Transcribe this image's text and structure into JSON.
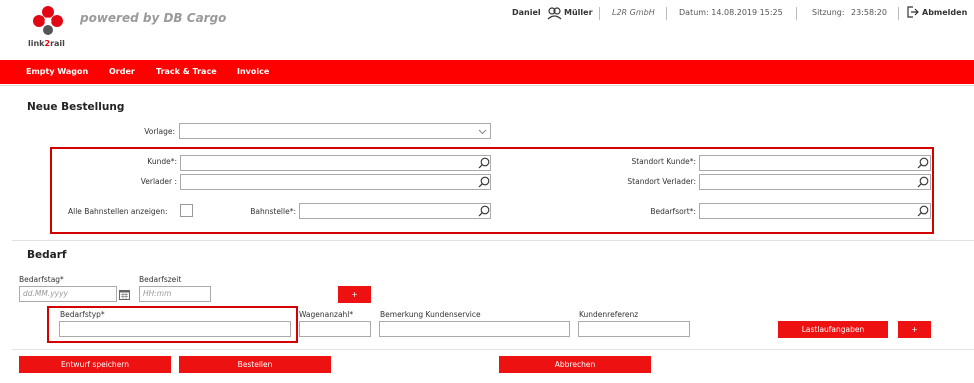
{
  "brand": {
    "logo_text_a": "link",
    "logo_text_b": "2",
    "logo_text_c": "rail",
    "powered_by": "powered by DB Cargo",
    "accent_color": "#ff0000"
  },
  "header": {
    "user_first": "Daniel",
    "user_last": "Müller",
    "company": "L2R GmbH",
    "datum": "Datum: 14.08.2019 15:25",
    "sitzung_label": "Sitzung:",
    "sitzung_value": "23:58:20",
    "logout": "Abmelden"
  },
  "nav": {
    "items": [
      "Empty Wagon",
      "Order",
      "Track & Trace",
      "Invoice"
    ]
  },
  "order": {
    "title": "Neue Bestellung",
    "vorlage_label": "Vorlage:",
    "kunde_label": "Kunde*:",
    "verlader_label": "Verlader :",
    "alle_label": "Alle Bahnstellen anzeigen:",
    "bahnstelle_label": "Bahnstelle*:",
    "standort_kunde_label": "Standort Kunde*:",
    "standort_verlader_label": "Standort Verlader:",
    "bedarfsort_label": "Bedarfsort*:"
  },
  "bedarf": {
    "title": "Bedarf",
    "tag_label": "Bedarfstag*",
    "tag_placeholder": "dd.MM.yyyy",
    "zeit_label": "Bedarfszeit",
    "zeit_placeholder": "HH:mm",
    "plus": "+",
    "typ_label": "Bedarfstyp*",
    "wagen_label": "Wagenanzahl*",
    "bemerkung_label": "Bemerkung Kundenservice",
    "kundenref_label": "Kundenreferenz",
    "lastlauf": "Lastlaufangaben"
  },
  "actions": {
    "entwurf": "Entwurf speichern",
    "bestellen": "Bestellen",
    "abbrechen": "Abbrechen"
  }
}
